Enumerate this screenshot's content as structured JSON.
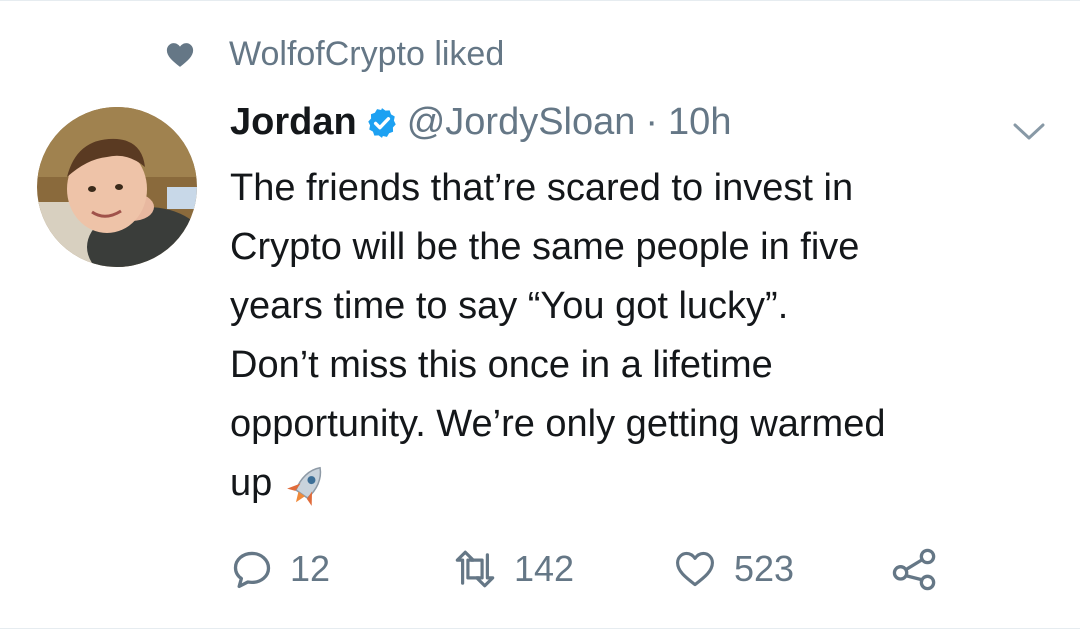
{
  "social_context": {
    "text": "WolfofCrypto liked",
    "icon": "heart-icon"
  },
  "tweet": {
    "name": "Jordan",
    "verified": true,
    "handle": "@JordySloan",
    "separator": "·",
    "time": "10h",
    "lines": [
      "The friends that’re scared to invest in",
      "Crypto will be the same people in five",
      "years time to say “You got lucky”.",
      "Don’t miss this once in a lifetime",
      "opportunity. We’re only getting warmed",
      "up"
    ],
    "emoji": "rocket-emoji"
  },
  "actions": {
    "replies": "12",
    "retweets": "142",
    "likes": "523"
  },
  "colors": {
    "text": "#14171a",
    "muted": "#657786",
    "verified": "#1da1f2"
  }
}
